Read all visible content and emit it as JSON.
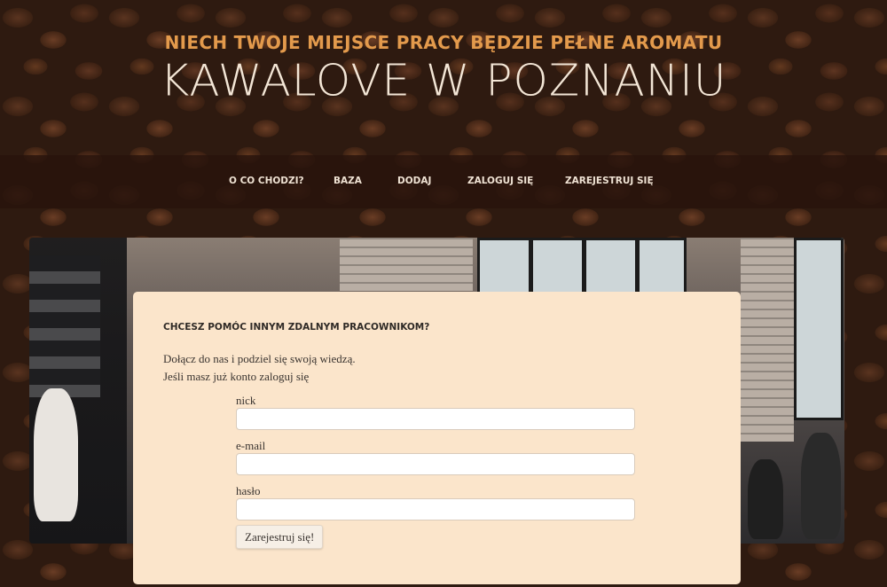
{
  "header": {
    "tagline": "NIECH TWOJE MIEJSCE PRACY BĘDZIE PEŁNE AROMATU",
    "title": "KAWALOVE W POZNANIU"
  },
  "nav": {
    "items": [
      {
        "label": "O CO CHODZI?"
      },
      {
        "label": "BAZA"
      },
      {
        "label": "DODAJ"
      },
      {
        "label": "ZALOGUJ SIĘ"
      },
      {
        "label": "ZAREJESTRUJ SIĘ"
      }
    ]
  },
  "register": {
    "heading": "CHCESZ POMÓC INNYM ZDALNYM PRACOWNIKOM?",
    "intro_line1": "Dołącz do nas i podziel się swoją wiedzą.",
    "intro_line2": "Jeśli masz już konto zaloguj się",
    "fields": [
      {
        "label": "nick",
        "value": ""
      },
      {
        "label": "e-mail",
        "value": ""
      },
      {
        "label": "hasło",
        "value": ""
      }
    ],
    "submit_label": "Zarejestruj się!"
  },
  "colors": {
    "accent": "#e39a4c",
    "nav_bg": "#28140c",
    "card_bg": "#fbe5cb"
  }
}
